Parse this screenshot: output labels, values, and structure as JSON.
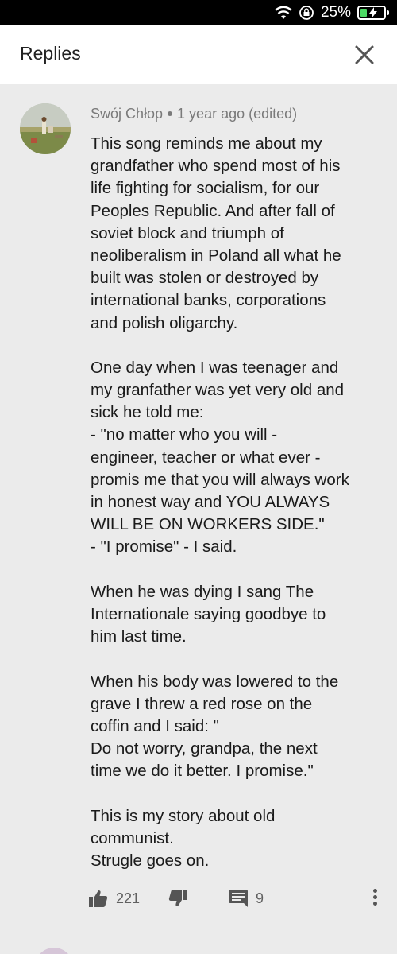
{
  "status_bar": {
    "battery_percent": "25%"
  },
  "header": {
    "title": "Replies"
  },
  "comment": {
    "author": "Swój Chłop",
    "time": "1 year ago (edited)",
    "body": [
      "This song reminds me about my",
      "grandfather who spend most of his",
      "life fighting for socialism, for our",
      "Peoples Republic. And after fall of",
      "soviet block and triumph of",
      "neoliberalism in Poland all what he",
      "built was stolen or destroyed by",
      "international banks, corporations",
      "and polish oligarchy.",
      "",
      "One day when I was teenager and",
      "my granfather was yet very old and",
      "sick he told me:",
      "- \"no matter who you will -",
      "engineer, teacher or what ever -",
      "promis me that you will always work",
      "in honest way and YOU ALWAYS",
      "WILL BE ON WORKERS SIDE.\"",
      "- \"I promise\" - I said.",
      "",
      "When he was dying I sang The",
      "Internationale saying goodbye to",
      "him last time.",
      "",
      "When his body was lowered to the",
      "grave I threw a red rose on the",
      "coffin and I said: \"",
      "Do not worry, grandpa, the next",
      "time we do it better. I promise.\"",
      "",
      "This is my story about old",
      "communist.",
      "Strugle goes on."
    ],
    "like_count": "221",
    "reply_count": "9"
  }
}
